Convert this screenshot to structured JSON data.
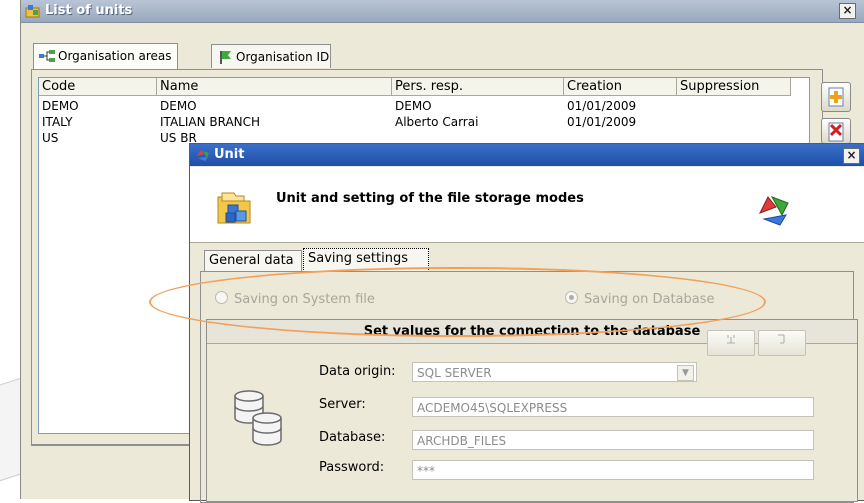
{
  "outer_window": {
    "title": "List of units",
    "close_glyph": "×",
    "tabs": [
      {
        "label": "Organisation areas",
        "icon": "hierarchy-icon"
      },
      {
        "label": "Organisation ID",
        "icon": "flag-icon"
      }
    ],
    "table": {
      "columns": [
        "Code",
        "Name",
        "Pers. resp.",
        "Creation",
        "Suppression"
      ],
      "rows": [
        {
          "code": "DEMO",
          "name": "DEMO",
          "resp": "DEMO",
          "creation": "01/01/2009",
          "suppression": ""
        },
        {
          "code": "ITALY",
          "name": "ITALIAN BRANCH",
          "resp": "Alberto Carrai",
          "creation": "01/01/2009",
          "suppression": ""
        },
        {
          "code": "US",
          "name": "US BR",
          "resp": "",
          "creation": "",
          "suppression": ""
        }
      ]
    }
  },
  "dialog": {
    "title": "Unit",
    "close_glyph": "×",
    "header_text": "Unit and setting of the file storage modes",
    "tabs": {
      "general": "General data",
      "saving": "Saving settings"
    },
    "radios": {
      "system_file": "Saving on System file",
      "database": "Saving on Database",
      "selected": "database"
    },
    "panel": {
      "title": "Set values for the connection to the database",
      "data_origin_label": "Data origin:",
      "data_origin_value": "SQL SERVER",
      "server_label": "Server:",
      "server_value": "ACDEMO45\\SQLEXPRESS",
      "database_label": "Database:",
      "database_value": "ARCHDB_FILES",
      "password_label": "Password:",
      "password_value": "***"
    }
  },
  "colors": {
    "outer_title_bg": "#9aa8bc",
    "dialog_title_bg": "#1f4fa8",
    "annotation_ellipse": "#f2a05a"
  }
}
